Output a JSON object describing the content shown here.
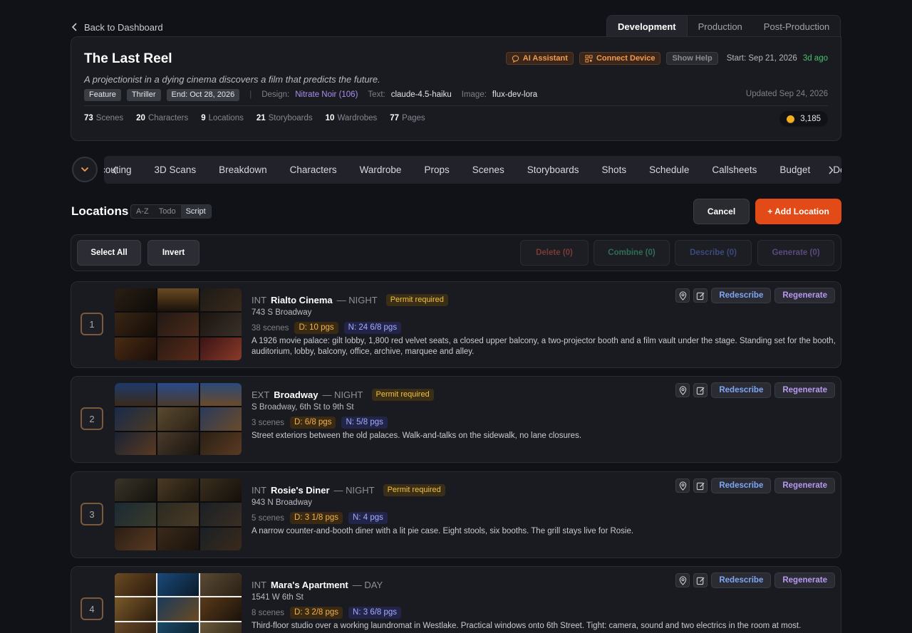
{
  "nav": {
    "back_label": "Back to Dashboard",
    "phase_tabs": [
      "Development",
      "Production",
      "Post-Production"
    ],
    "active_phase": "Development"
  },
  "project": {
    "title": "The Last Reel",
    "logline": "A projectionist in a dying cinema discovers a film that predicts the future.",
    "ai_assistant_label": "AI Assistant",
    "connect_device_label": "Connect Device",
    "show_help_label": "Show Help",
    "start_date": "Start: Sep 21, 2026",
    "ago": "3d ago",
    "tags": [
      "Feature",
      "Thriller",
      "End: Oct 28, 2026"
    ],
    "design_label": "Design:",
    "design_value": "Nitrate Noir (106)",
    "text_label": "Text:",
    "text_value": "claude-4.5-haiku",
    "image_label": "Image:",
    "image_value": "flux-dev-lora",
    "updated": "Updated Sep 24, 2026",
    "stats": [
      {
        "num": "73",
        "label": "Scenes"
      },
      {
        "num": "20",
        "label": "Characters"
      },
      {
        "num": "9",
        "label": "Locations"
      },
      {
        "num": "21",
        "label": "Storyboards"
      },
      {
        "num": "10",
        "label": "Wardrobes"
      },
      {
        "num": "77",
        "label": "Pages"
      }
    ],
    "credits": "3,185"
  },
  "section_tabs": [
    "Scouting",
    "3D Scans",
    "Breakdown",
    "Characters",
    "Wardrobe",
    "Props",
    "Scenes",
    "Storyboards",
    "Shots",
    "Schedule",
    "Callsheets",
    "Budget",
    "Deals"
  ],
  "locations_header": {
    "title": "Locations",
    "sort_options": [
      "A-Z",
      "Todo",
      "Script"
    ],
    "active_sort": "Script",
    "cancel_label": "Cancel",
    "add_label": "+ Add Location"
  },
  "bulk": {
    "select_all": "Select All",
    "invert": "Invert",
    "delete": "Delete (0)",
    "combine": "Combine (0)",
    "describe": "Describe (0)",
    "generate": "Generate (0)"
  },
  "colors": {
    "accent": "#e24a17",
    "delete_text": "#7a3a34",
    "combine_text": "#2f6e55",
    "describe_text": "#3b4a7e",
    "generate_text": "#5a4a7e"
  },
  "action_labels": {
    "redescribe": "Redescribe",
    "regenerate": "Regenerate"
  },
  "locations": [
    {
      "number": "1",
      "ie": "INT",
      "name": "Rialto Cinema",
      "tod": "— NIGHT",
      "permit": "Permit required",
      "address": "743 S Broadway",
      "scenes": "38 scenes",
      "d_pages": "D: 10 pgs",
      "n_pages": "N: 24 6/8 pgs",
      "description": "A 1926 movie palace: gilt lobby, 1,800 red velvet seats, a closed upper balcony, a two-projector booth and a film vault under the stage. Standing set for the booth, auditorium, lobby, balcony, office, archive, marquee and alley."
    },
    {
      "number": "2",
      "ie": "EXT",
      "name": "Broadway",
      "tod": "— NIGHT",
      "permit": "Permit required",
      "address": "S Broadway, 6th St to 9th St",
      "scenes": "3 scenes",
      "d_pages": "D: 6/8 pgs",
      "n_pages": "N: 5/8 pgs",
      "description": "Street exteriors between the old palaces. Walk-and-talks on the sidewalk, no lane closures."
    },
    {
      "number": "3",
      "ie": "INT",
      "name": "Rosie's Diner",
      "tod": "— NIGHT",
      "permit": "Permit required",
      "address": "943 N Broadway",
      "scenes": "5 scenes",
      "d_pages": "D: 3 1/8 pgs",
      "n_pages": "N: 4 pgs",
      "description": "A narrow counter-and-booth diner with a lit pie case. Eight stools, six booths. The grill stays live for Rosie."
    },
    {
      "number": "4",
      "ie": "INT",
      "name": "Mara's Apartment",
      "tod": "— DAY",
      "permit": "",
      "address": "1541 W 6th St",
      "scenes": "8 scenes",
      "d_pages": "D: 3 2/8 pgs",
      "n_pages": "N: 3 6/8 pgs",
      "description": "Third-floor studio over a working laundromat in Westlake. Practical windows onto 6th Street. Tight: camera, sound and two electrics in the room at most."
    }
  ]
}
